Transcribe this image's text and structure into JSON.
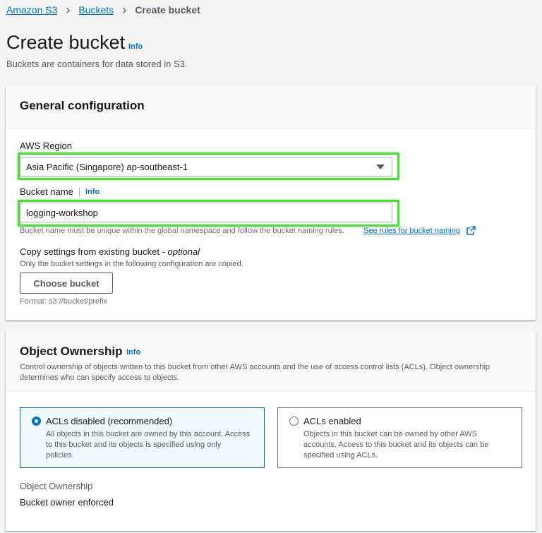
{
  "breadcrumb": {
    "items": [
      "Amazon S3",
      "Buckets"
    ],
    "current": "Create bucket"
  },
  "header": {
    "title": "Create bucket",
    "info": "Info",
    "description": "Buckets are containers for data stored in S3."
  },
  "general": {
    "heading": "General configuration",
    "region_label": "AWS Region",
    "region_value": "Asia Pacific (Singapore) ap-southeast-1",
    "bucket_name_label": "Bucket name",
    "bucket_name_info": "Info",
    "bucket_name_value": "logging-workshop",
    "bucket_name_hint": "Bucket name must be unique within the global namespace and follow the bucket naming rules.",
    "bucket_name_rules_link": "See rules for bucket naming",
    "copy_label": "Copy settings from existing bucket - ",
    "copy_optional": "optional",
    "copy_desc": "Only the bucket settings in the following configuration are copied.",
    "choose_button": "Choose bucket",
    "format_hint": "Format: s3://bucket/prefix"
  },
  "ownership": {
    "heading": "Object Ownership",
    "info": "Info",
    "description": "Control ownership of objects written to this bucket from other AWS accounts and the use of access control lists (ACLs). Object ownership determines who can specify access to objects.",
    "options": [
      {
        "title": "ACLs disabled (recommended)",
        "desc": "All objects in this bucket are owned by this account. Access to this bucket and its objects is specified using only policies.",
        "selected": true
      },
      {
        "title": "ACLs enabled",
        "desc": "Objects in this bucket can be owned by other AWS accounts. Access to this bucket and its objects can be specified using ACLs.",
        "selected": false
      }
    ],
    "summary_label": "Object Ownership",
    "summary_value": "Bucket owner enforced"
  },
  "colors": {
    "link": "#0073bb",
    "highlight": "#4cdc3a",
    "selected_bg": "#f1faff"
  }
}
